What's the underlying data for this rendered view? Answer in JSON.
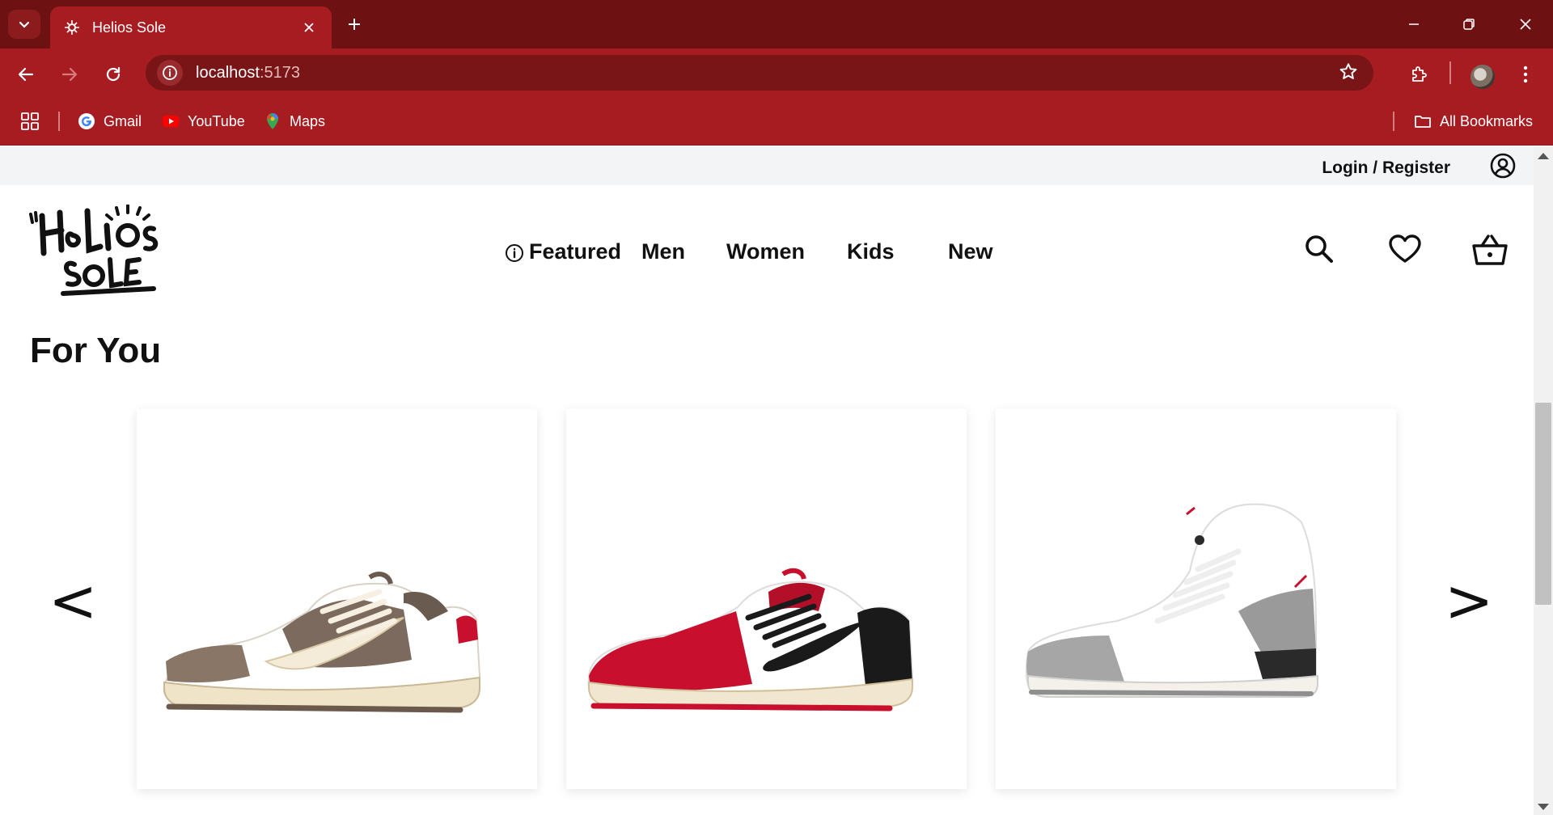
{
  "browser": {
    "tab_title": "Helios Sole",
    "url_host": "localhost",
    "url_port": ":5173",
    "bookmarks": [
      {
        "label": "Gmail",
        "icon": "gmail-icon"
      },
      {
        "label": "YouTube",
        "icon": "youtube-icon"
      },
      {
        "label": "Maps",
        "icon": "maps-icon"
      }
    ],
    "all_bookmarks_label": "All Bookmarks",
    "theme_color": "#a61c21",
    "tabbar_color": "#6e1112"
  },
  "header": {
    "login_label": "Login / Register",
    "logo_text": "Helios Sole",
    "nav": {
      "featured": "Featured",
      "men": "Men",
      "women": "Women",
      "kids": "Kids",
      "new": "New"
    }
  },
  "main": {
    "section_title": "For You",
    "prev_arrow": "<",
    "next_arrow": ">",
    "products": [
      {
        "name": "Brown and sail low-top sneaker",
        "colors": [
          "#7b6a5d",
          "#f4ecd9",
          "#ffffff"
        ]
      },
      {
        "name": "Red, white and black low-top sneaker",
        "colors": [
          "#c8102e",
          "#1a1a1a",
          "#ffffff"
        ]
      },
      {
        "name": "White cement mid-top sneaker",
        "colors": [
          "#ffffff",
          "#8f8f8f",
          "#2a2a2a"
        ]
      }
    ]
  }
}
